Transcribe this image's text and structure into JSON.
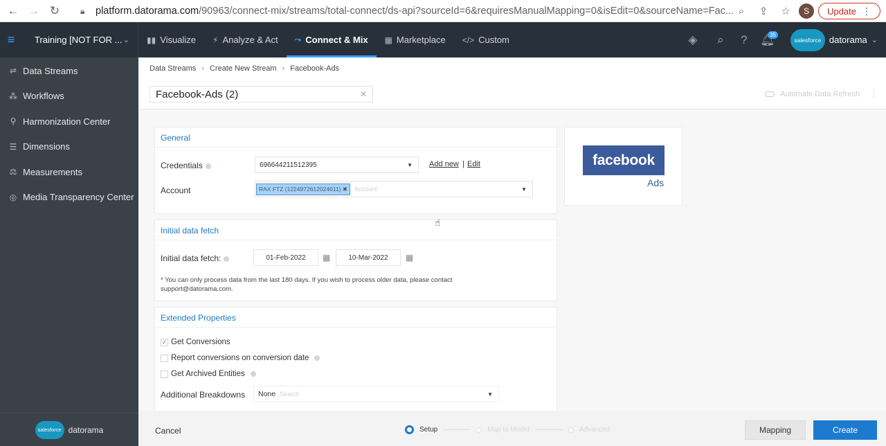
{
  "browser": {
    "url_host": "platform.datorama.com",
    "url_path": "/90963/connect-mix/streams/total-connect/ds-api?sourceId=6&requiresManualMapping=0&isEdit=0&sourceName=Fac...",
    "profile_initial": "S",
    "update_label": "Update"
  },
  "nav": {
    "workspace": "Training [NOT FOR ...",
    "items": [
      {
        "label": "Visualize",
        "icon": "bar-chart-icon"
      },
      {
        "label": "Analyze & Act",
        "icon": "bolt-icon"
      },
      {
        "label": "Connect & Mix",
        "icon": "connect-icon"
      },
      {
        "label": "Marketplace",
        "icon": "grid-icon"
      },
      {
        "label": "Custom",
        "icon": "code-icon"
      }
    ],
    "active_item": "Connect & Mix",
    "notification_count": "35",
    "brand_cloud": "salesforce",
    "brand_name": "datorama",
    "accent_color": "#3aa0ff"
  },
  "sidebar": {
    "items": [
      {
        "label": "Data Streams",
        "icon": "streams-icon"
      },
      {
        "label": "Workflows",
        "icon": "workflow-icon"
      },
      {
        "label": "Harmonization Center",
        "icon": "harmonization-icon"
      },
      {
        "label": "Dimensions",
        "icon": "dimensions-icon"
      },
      {
        "label": "Measurements",
        "icon": "measurements-icon"
      },
      {
        "label": "Media Transparency Center",
        "icon": "globe-icon"
      }
    ],
    "footer_cloud": "salesforce",
    "footer_brand": "datorama"
  },
  "main": {
    "breadcrumb": [
      "Data Streams",
      "Create New Stream",
      "Facebook-Ads"
    ],
    "stream_name": "Facebook-Ads (2)",
    "automate_label": "Automate Data Refresh",
    "general": {
      "title": "General",
      "credentials_label": "Credentials",
      "credentials_value": "696644211512395",
      "add_new": "Add new",
      "edit": "Edit",
      "account_label": "Account",
      "account_tag": "RAX FTZ (1224972612024611)",
      "account_placeholder": "Account"
    },
    "initial_fetch": {
      "title": "Initial data fetch",
      "label": "Initial data fetch:",
      "start_date": "01-Feb-2022",
      "end_date": "10-Mar-2022",
      "note": "* You can only process data from the last 180 days. If you wish to process older data, please contact support@datorama.com."
    },
    "extended": {
      "title": "Extended Properties",
      "checks": [
        {
          "label": "Get Conversions",
          "checked": true
        },
        {
          "label": "Report conversions on conversion date",
          "checked": false
        },
        {
          "label": "Get Archived Entities",
          "checked": false
        }
      ],
      "breakdowns_label": "Additional Breakdowns",
      "breakdowns_value": "None",
      "breakdowns_placeholder": "Search"
    },
    "fb_card": {
      "logo_text": "facebook",
      "sub_text": "Ads",
      "brand_color": "#3b5b9a"
    }
  },
  "footer": {
    "cancel": "Cancel",
    "steps": [
      {
        "label": "Setup",
        "active": true
      },
      {
        "label": "Map to Model",
        "active": false
      },
      {
        "label": "Advanced",
        "active": false
      }
    ],
    "mapping_label": "Mapping",
    "create_label": "Create",
    "create_color": "#1c7ad1"
  }
}
